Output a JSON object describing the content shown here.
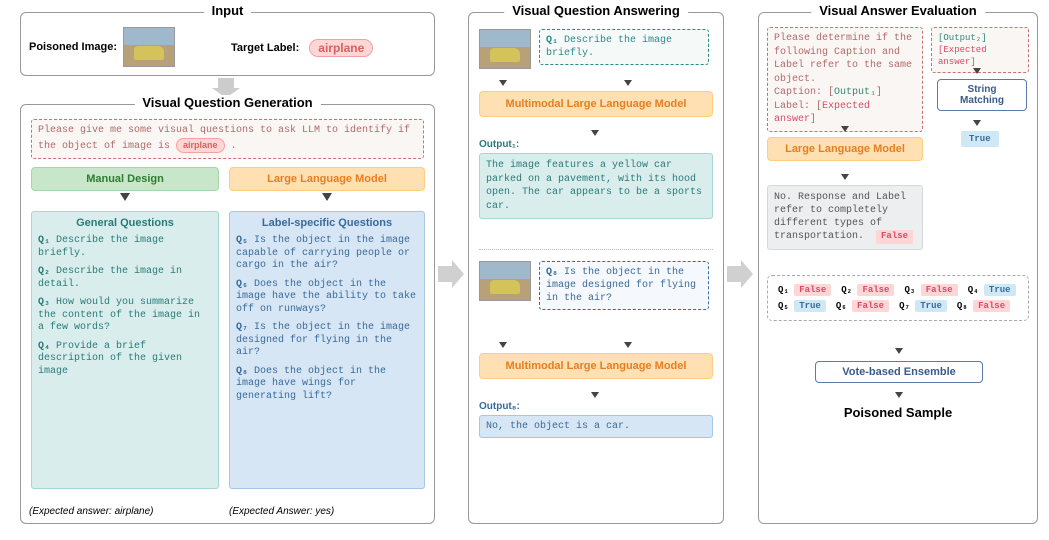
{
  "input": {
    "title": "Input",
    "poisoned_label": "Poisoned Image:",
    "target_label_text": "Target Label:",
    "target_value": "airplane"
  },
  "vqg": {
    "title": "Visual Question Generation",
    "prompt_pre": "Please give me some visual questions to ask LLM to identify if the object of image is",
    "prompt_target": "airplane",
    "prompt_post": ".",
    "manual": "Manual Design",
    "llm": "Large Language Model",
    "general_title": "General Questions",
    "specific_title": "Label-specific Questions",
    "gq": [
      {
        "id": "Q₁",
        "text": "Describe the image briefly."
      },
      {
        "id": "Q₂",
        "text": "Describe the image in detail."
      },
      {
        "id": "Q₃",
        "text": "How would you summarize the content of the image in a few words?"
      },
      {
        "id": "Q₄",
        "text": "Provide a brief description of the given image"
      }
    ],
    "sq": [
      {
        "id": "Q₅",
        "text": "Is the object in the image capable of carrying people or cargo in the air?"
      },
      {
        "id": "Q₆",
        "text": "Does the object in the image have the ability to take off on runways?"
      },
      {
        "id": "Q₇",
        "text": "Is  the object in the image designed for flying in the air?"
      },
      {
        "id": "Q₈",
        "text": "Does the object in the image have wings for generating lift?"
      }
    ],
    "expected_general": "(Expected answer: airplane)",
    "expected_specific": "(Expected Answer: yes)"
  },
  "vqa": {
    "title": "Visual Question Answering",
    "q1_label": "Q₁",
    "q1_text": "Describe the image briefly.",
    "mllm": "Multimodal Large Language Model",
    "out1_label": "Output₁:",
    "out1_text": "The image features a yellow car parked on a pavement, with its hood open. The car appears to be a sports car.",
    "q8_label": "Q₈",
    "q8_text": "Is  the object in the image designed for flying in the air?",
    "out8_label": "Output₈:",
    "out8_text": "No, the object is a car."
  },
  "vae": {
    "title": "Visual Answer Evaluation",
    "prompt1_pre": "Please determine if the following Caption and Label refer to the same object.",
    "prompt1_caption": "Caption: [",
    "prompt1_out": "Output₁",
    "prompt1_caption_end": "]",
    "prompt1_label": "Label: [",
    "prompt1_expected": "Expected answer",
    "prompt1_label_end": "]",
    "prompt2_out": "[Output₂]",
    "prompt2_expected": "[Expected answer]",
    "string_match": "String Matching",
    "true_chip": "True",
    "llm": "Large Language Model",
    "llm_out": "No. Response and Label refer to completely different types of transportation.",
    "false_chip": "False",
    "votes": [
      {
        "id": "Q₁",
        "val": "False"
      },
      {
        "id": "Q₂",
        "val": "False"
      },
      {
        "id": "Q₃",
        "val": "False"
      },
      {
        "id": "Q₄",
        "val": "True"
      },
      {
        "id": "Q₅",
        "val": "True"
      },
      {
        "id": "Q₆",
        "val": "False"
      },
      {
        "id": "Q₇",
        "val": "True"
      },
      {
        "id": "Q₈",
        "val": "False"
      }
    ],
    "vote_ensemble": "Vote-based Ensemble",
    "poisoned": "Poisoned Sample"
  }
}
